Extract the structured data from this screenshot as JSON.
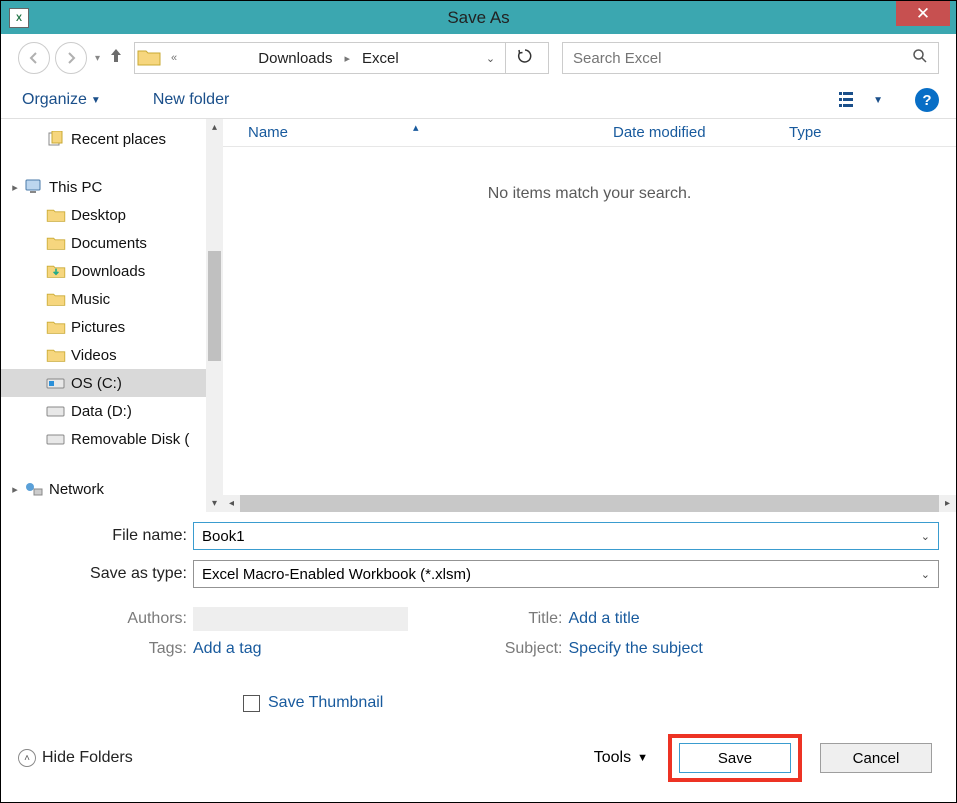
{
  "titlebar": {
    "title": "Save As"
  },
  "nav": {
    "breadcrumb_chev": "«",
    "breadcrumb": [
      "Downloads",
      "Excel"
    ],
    "search_placeholder": "Search Excel"
  },
  "toolbar": {
    "organize": "Organize",
    "new_folder": "New folder"
  },
  "sidebar": {
    "recent_places": "Recent places",
    "this_pc": "This PC",
    "children": [
      "Desktop",
      "Documents",
      "Downloads",
      "Music",
      "Pictures",
      "Videos",
      "OS (C:)",
      "Data (D:)",
      "Removable Disk ("
    ],
    "network": "Network"
  },
  "columns": {
    "name": "Name",
    "date": "Date modified",
    "type": "Type"
  },
  "content": {
    "empty": "No items match your search."
  },
  "form": {
    "filename_label": "File name:",
    "filename_value": "Book1",
    "saveas_label": "Save as type:",
    "saveas_value": "Excel Macro-Enabled Workbook (*.xlsm)"
  },
  "meta": {
    "authors_label": "Authors:",
    "tags_label": "Tags:",
    "tags_value": "Add a tag",
    "title_label": "Title:",
    "title_value": "Add a title",
    "subject_label": "Subject:",
    "subject_value": "Specify the subject",
    "thumb_label": "Save Thumbnail"
  },
  "footer": {
    "hide_folders": "Hide Folders",
    "tools": "Tools",
    "save": "Save",
    "cancel": "Cancel"
  }
}
